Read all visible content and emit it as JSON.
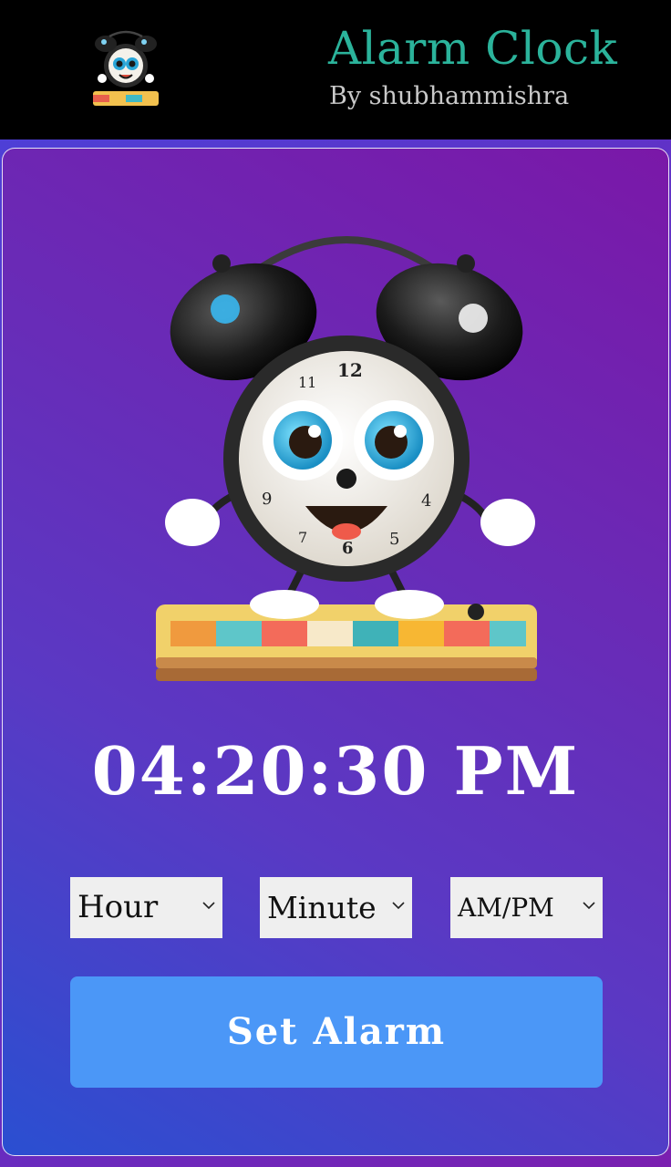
{
  "header": {
    "title": "Alarm Clock",
    "author": "By shubhammishra",
    "logo_icon": "alarm-clock-mascot-icon",
    "title_color": "#2bb39b"
  },
  "main": {
    "illustration_icon": "alarm-clock-mascot-illustration",
    "current_time": "04:20:30 PM",
    "selects": {
      "hour": "Hour",
      "minute": "Minute",
      "ampm": "AM/PM"
    },
    "set_alarm_label": "Set Alarm",
    "button_color": "#4b97f7"
  }
}
